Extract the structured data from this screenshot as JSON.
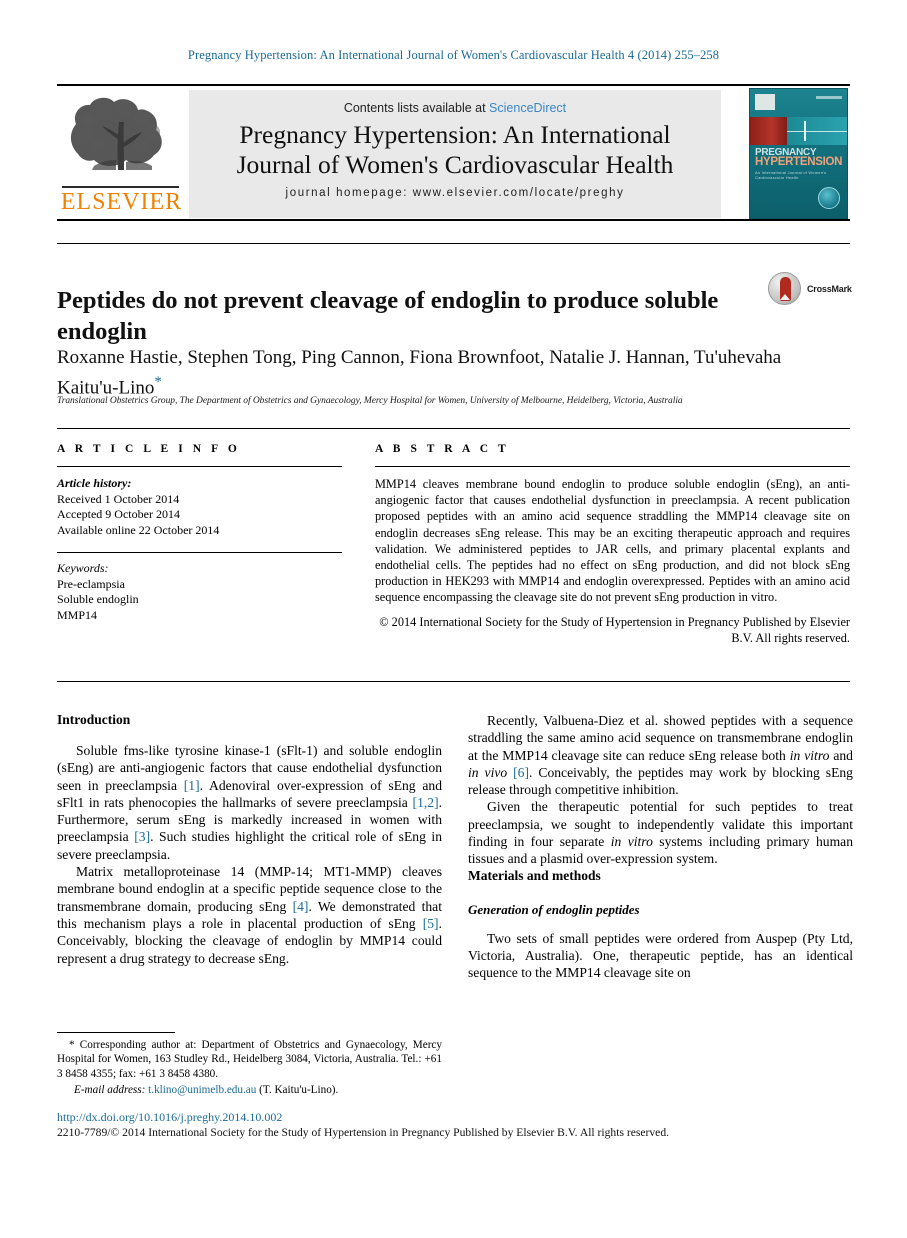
{
  "running_head": "Pregnancy Hypertension: An International Journal of Women's Cardiovascular Health 4 (2014) 255–258",
  "masthead": {
    "contents_prefix": "Contents lists available at ",
    "sciencedirect": "ScienceDirect",
    "journal_title_line1": "Pregnancy Hypertension: An International",
    "journal_title_line2": "Journal of Women's Cardiovascular Health",
    "homepage": "journal homepage: www.elsevier.com/locate/preghy",
    "publisher_wordmark": "ELSEVIER",
    "cover": {
      "title_line1": "PREGNANCY",
      "title_line2": "HYPERTENSION",
      "subtitle": "An International Journal of Women's Cardiovascular Health"
    }
  },
  "article": {
    "title": "Peptides do not prevent cleavage of endoglin to produce soluble endoglin",
    "crossmark_label": "CrossMark",
    "authors": "Roxanne Hastie, Stephen Tong, Ping Cannon, Fiona Brownfoot, Natalie J. Hannan, Tu'uhevaha Kaitu'u-Lino",
    "corresponding_marker": "*",
    "affiliation": "Translational Obstetrics Group, The Department of Obstetrics and Gynaecology, Mercy Hospital for Women, University of Melbourne, Heidelberg, Victoria, Australia"
  },
  "article_info": {
    "heading": "A R T I C L E   I N F O",
    "history_label": "Article history:",
    "received": "Received 1 October 2014",
    "accepted": "Accepted 9 October 2014",
    "available": "Available online 22 October 2014",
    "keywords_label": "Keywords:",
    "keywords": [
      "Pre-eclampsia",
      "Soluble endoglin",
      "MMP14"
    ]
  },
  "abstract": {
    "heading": "A B S T R A C T",
    "text": "MMP14 cleaves membrane bound endoglin to produce soluble endoglin (sEng), an anti-angiogenic factor that causes endothelial dysfunction in preeclampsia. A recent publication proposed peptides with an amino acid sequence straddling the MMP14 cleavage site on endoglin decreases sEng release. This may be an exciting therapeutic approach and requires validation. We administered peptides to JAR cells, and primary placental explants and endothelial cells. The peptides had no effect on sEng production, and did not block sEng production in HEK293 with MMP14 and endoglin overexpressed. Peptides with an amino acid sequence encompassing the cleavage site do not prevent sEng production in vitro.",
    "copyright": "© 2014 International Society for the Study of Hypertension in Pregnancy Published by Elsevier B.V. All rights reserved."
  },
  "body": {
    "introduction_heading": "Introduction",
    "intro_p1_a": "Soluble fms-like tyrosine kinase-1 (sFlt-1) and soluble endoglin (sEng) are anti-angiogenic factors that cause endothelial dysfunction seen in preeclampsia ",
    "intro_p1_ref1": "[1]",
    "intro_p1_b": ". Adenoviral over-expression of sEng and sFlt1 in rats phenocopies the hallmarks of severe preeclampsia ",
    "intro_p1_ref2": "[1,2]",
    "intro_p1_c": ". Furthermore, serum sEng is markedly increased in women with preeclampsia ",
    "intro_p1_ref3": "[3]",
    "intro_p1_d": ". Such studies highlight the critical role of sEng in severe preeclampsia.",
    "intro_p2_a": "Matrix metalloproteinase 14 (MMP-14; MT1-MMP) cleaves membrane bound endoglin at a specific peptide sequence close to the transmembrane domain, producing sEng ",
    "intro_p2_ref1": "[4]",
    "intro_p2_b": ". We demonstrated that this mechanism plays a role in placental production of sEng ",
    "intro_p2_ref2": "[5]",
    "intro_p2_c": ". Conceivably, blocking the cleavage of endoglin by MMP14 could represent a drug strategy to decrease sEng.",
    "intro_p3_a": "Recently, Valbuena-Diez et al. showed peptides with a sequence straddling the same amino acid sequence on transmembrane endoglin at the MMP14 cleavage site can reduce sEng release both ",
    "intro_p3_it1": "in vitro",
    "intro_p3_b": " and ",
    "intro_p3_it2": "in vivo",
    "intro_p3_c": " ",
    "intro_p3_ref1": "[6]",
    "intro_p3_d": ". Conceivably, the peptides may work by blocking sEng release through competitive inhibition.",
    "intro_p4_a": "Given the therapeutic potential for such peptides to treat preeclampsia, we sought to independently validate this important finding in four separate ",
    "intro_p4_it1": "in vitro",
    "intro_p4_b": " systems including primary human tissues and a plasmid over-expression system.",
    "methods_heading": "Materials and methods",
    "methods_subheading": "Generation of endoglin peptides",
    "methods_p1": "Two sets of small peptides were ordered from Auspep (Pty Ltd, Victoria, Australia). One, therapeutic peptide, has an identical sequence to the MMP14 cleavage site on"
  },
  "footnote": {
    "marker": "*",
    "corresponding": " Corresponding author at: Department of Obstetrics and Gynaecology, Mercy Hospital for Women, 163 Studley Rd., Heidelberg 3084, Victoria, Australia. Tel.: +61 3 8458 4355; fax: +61 3 8458 4380.",
    "email_label": "E-mail address:",
    "email": "t.klino@unimelb.edu.au",
    "email_owner": " (T. Kaitu'u-Lino).",
    "doi": "http://dx.doi.org/10.1016/j.preghy.2014.10.002",
    "issn_copy": "2210-7789/© 2014 International Society for the Study of Hypertension in Pregnancy Published by Elsevier B.V. All rights reserved."
  },
  "colors": {
    "link": "#1a6a96",
    "elsevier_orange": "#ef8200",
    "sciencedirect_blue": "#3a86c8",
    "cover_teal": "#0f6b79",
    "crossmark_red": "#b02a1e"
  }
}
